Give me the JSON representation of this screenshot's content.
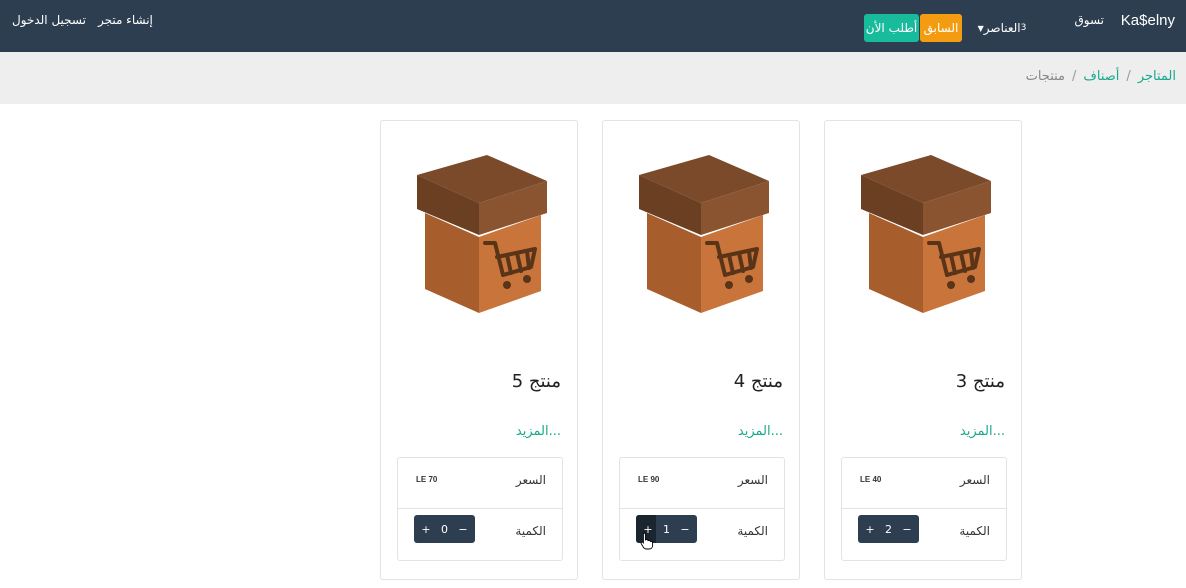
{
  "nav": {
    "brand": "Ka$elny",
    "shop": "تسوق",
    "login": "تسجيل الدخول",
    "create_store": "إنشاء متجر"
  },
  "breadcrumb": {
    "stores": "المتاجر",
    "categories": "أصناف",
    "products": "منتجات",
    "sep": "/"
  },
  "buttons": {
    "cart_label": "العناصر",
    "cart_count": "3",
    "previous": "السابق",
    "order_now": "أطلب الأن"
  },
  "products": [
    {
      "title": "منتج 3",
      "more": "...المزيد",
      "price_label": "السعر",
      "price": "LE 40",
      "qty_label": "الكمية",
      "qty": "2",
      "minus": "−",
      "plus": "+"
    },
    {
      "title": "منتج 4",
      "more": "...المزيد",
      "price_label": "السعر",
      "price": "LE 90",
      "qty_label": "الكمية",
      "qty": "1",
      "minus": "−",
      "plus": "+"
    },
    {
      "title": "منتج 5",
      "more": "...المزيد",
      "price_label": "السعر",
      "price": "LE 70",
      "qty_label": "الكمية",
      "qty": "0",
      "minus": "−",
      "plus": "+"
    }
  ],
  "colors": {
    "navbar": "#2c3e50",
    "accent": "#18bc9c",
    "warning": "#f39c12",
    "box_dark": "#7a4a2a",
    "box_light": "#c8743a"
  }
}
